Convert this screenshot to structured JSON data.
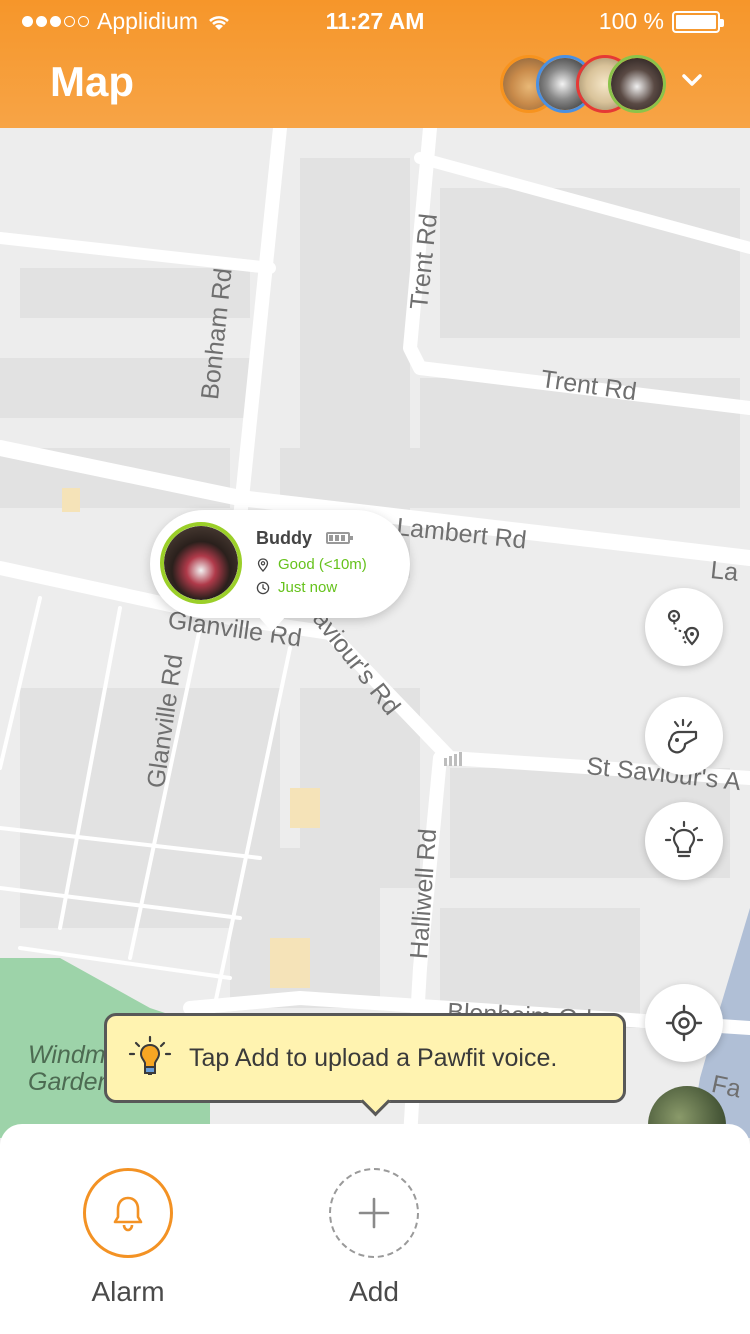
{
  "status_bar": {
    "carrier": "Applidium",
    "time": "11:27 AM",
    "battery": "100 %"
  },
  "header": {
    "title": "Map",
    "avatar_ring_colors": [
      "#f7931e",
      "#4a90e2",
      "#e53935",
      "#8bc34a"
    ]
  },
  "map": {
    "road_labels": {
      "bonham": "Bonham Rd",
      "trent_vertical": "Trent Rd",
      "trent_horizontal": "Trent Rd",
      "lambert": "Lambert Rd",
      "lambert_cut": "La",
      "glanville_horizontal": "Glanville Rd",
      "glanville_vertical": "Glanville Rd",
      "st_saviours_diag": "St Saviour's Rd",
      "st_saviours_h": "St Saviour's A",
      "halliwell": "Halliwell Rd",
      "windmill": "Windmill Gardens",
      "blenheim": "Blenheim Gdns",
      "fa": "Fa"
    }
  },
  "pet": {
    "name": "Buddy",
    "signal": "Good (<10m)",
    "last_seen": "Just now",
    "signal_color": "#66c21c"
  },
  "tooltip": {
    "text": "Tap Add to upload a Pawfit voice."
  },
  "actions": {
    "alarm_label": "Alarm",
    "add_label": "Add"
  },
  "icons": {
    "route": "route-icon",
    "whistle": "whistle-icon",
    "light": "lightbulb-icon",
    "locate": "locate-icon"
  }
}
